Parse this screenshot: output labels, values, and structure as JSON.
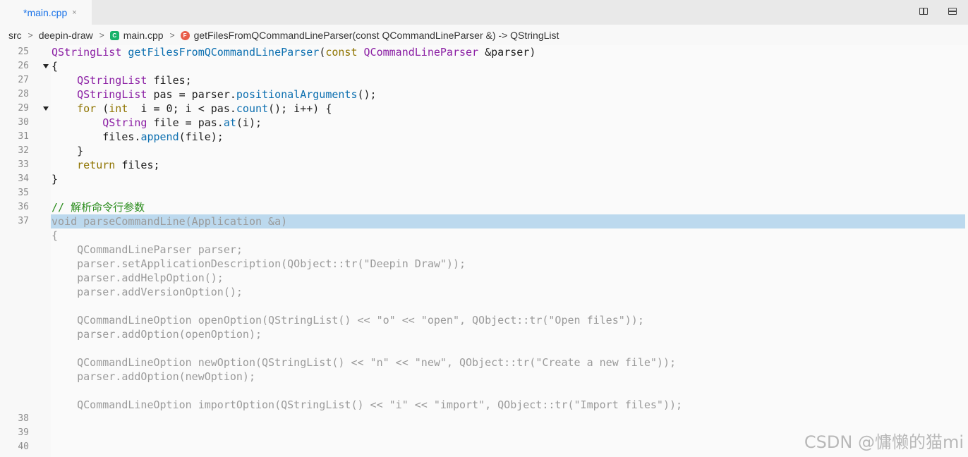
{
  "tab": {
    "label": "*main.cpp",
    "close": "×"
  },
  "toolbar": {
    "split_icon": "split-editor-icon",
    "panel_icon": "toggle-panel-icon"
  },
  "breadcrumb": {
    "items": [
      "src",
      "deepin-draw",
      "main.cpp",
      "getFilesFromQCommandLineParser(const QCommandLineParser &) -> QStringList"
    ],
    "file_icon_text": "C",
    "func_icon_text": "F"
  },
  "gutter": {
    "line_numbers": [
      "25",
      "26",
      "27",
      "28",
      "29",
      "30",
      "31",
      "32",
      "33",
      "34",
      "35",
      "36",
      "37",
      "38",
      "39",
      "40"
    ]
  },
  "code": {
    "l25": [
      "QStringList",
      " ",
      "getFilesFromQCommandLineParser",
      "(",
      "const",
      " ",
      "QCommandLineParser",
      " &parser)"
    ],
    "l26": "{",
    "l27": [
      "    ",
      "QStringList",
      " files;"
    ],
    "l28": [
      "    ",
      "QStringList",
      " pas = parser.",
      "positionalArguments",
      "();"
    ],
    "l29": [
      "    ",
      "for",
      " (",
      "int",
      "  i = 0; i < pas.",
      "count",
      "(); i++) {"
    ],
    "l30": [
      "        ",
      "QString",
      " file = pas.",
      "at",
      "(i);"
    ],
    "l31": [
      "        files.",
      "append",
      "(file);"
    ],
    "l32": "    }",
    "l33": [
      "    ",
      "return",
      " files;"
    ],
    "l34": "}",
    "l36": "// 解析命令行参数",
    "l37": "void parseCommandLine(Application &a)",
    "ghost": [
      "{",
      "    QCommandLineParser parser;",
      "    parser.setApplicationDescription(QObject::tr(\"Deepin Draw\"));",
      "    parser.addHelpOption();",
      "    parser.addVersionOption();",
      "",
      "    QCommandLineOption openOption(QStringList() << \"o\" << \"open\", QObject::tr(\"Open files\"));",
      "    parser.addOption(openOption);",
      "",
      "    QCommandLineOption newOption(QStringList() << \"n\" << \"new\", QObject::tr(\"Create a new file\"));",
      "    parser.addOption(newOption);",
      "",
      "    QCommandLineOption importOption(QStringList() << \"i\" << \"import\", QObject::tr(\"Import files\"));"
    ]
  },
  "watermark": "CSDN @慵懒的猫mi"
}
